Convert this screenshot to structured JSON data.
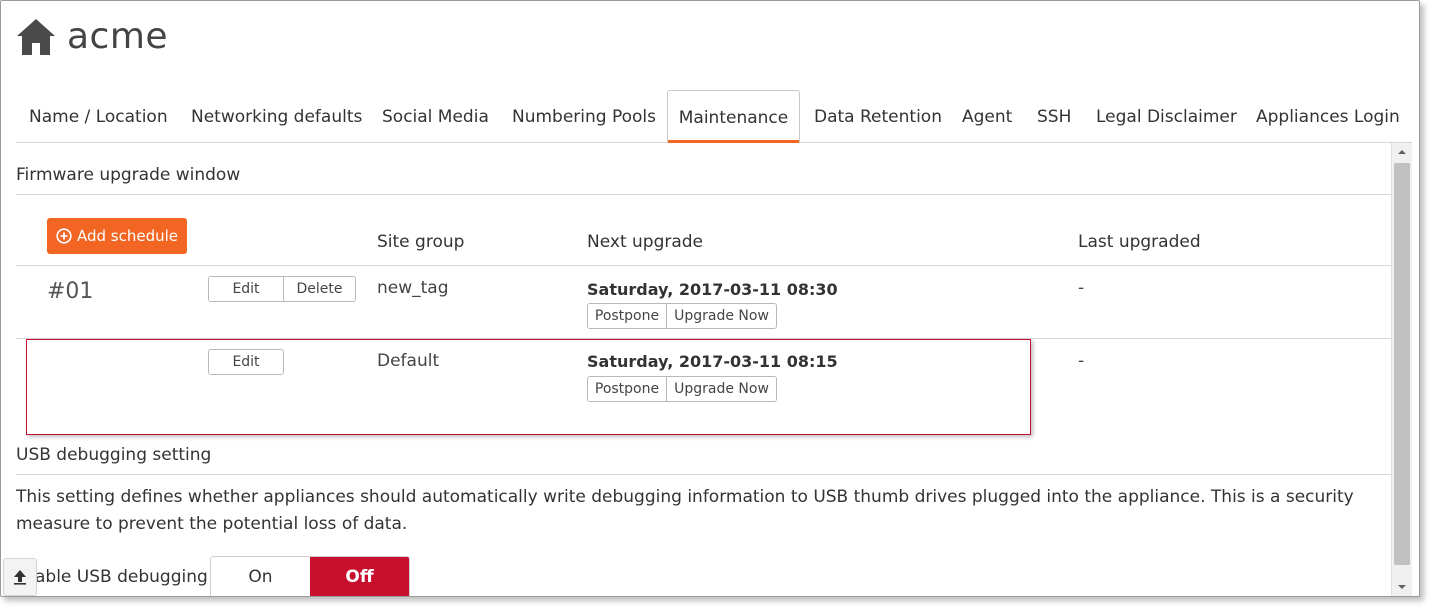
{
  "brand": {
    "name": "acme",
    "icon": "home-icon"
  },
  "tabs": [
    {
      "label": "Name / Location",
      "active": false
    },
    {
      "label": "Networking defaults",
      "active": false
    },
    {
      "label": "Social Media",
      "active": false
    },
    {
      "label": "Numbering Pools",
      "active": false
    },
    {
      "label": "Maintenance",
      "active": true
    },
    {
      "label": "Data Retention",
      "active": false
    },
    {
      "label": "Agent",
      "active": false
    },
    {
      "label": "SSH",
      "active": false
    },
    {
      "label": "Legal Disclaimer",
      "active": false
    },
    {
      "label": "Appliances Login",
      "active": false
    }
  ],
  "firmware": {
    "title": "Firmware upgrade window",
    "add_button": "Add schedule",
    "add_icon": "plus-circle-icon",
    "columns": {
      "site_group": "Site group",
      "next_upgrade": "Next upgrade",
      "last_upgraded": "Last upgraded"
    },
    "rows": [
      {
        "number": "#01",
        "edit": "Edit",
        "delete": "Delete",
        "site_group": "new_tag",
        "next_upgrade": "Saturday, 2017-03-11 08:30",
        "postpone": "Postpone",
        "upgrade_now": "Upgrade Now",
        "last_upgraded": "-"
      },
      {
        "number": "",
        "edit": "Edit",
        "site_group": "Default",
        "next_upgrade": "Saturday, 2017-03-11 08:15",
        "postpone": "Postpone",
        "upgrade_now": "Upgrade Now",
        "last_upgraded": "-"
      }
    ]
  },
  "usb": {
    "title": "USB debugging setting",
    "description": "This setting defines whether appliances should automatically write debugging information to USB thumb drives plugged into the appliance. This is a security measure to prevent the potential loss of data.",
    "toggle_label": "able USB debugging",
    "on_label": "On",
    "off_label": "Off",
    "selected": "Off"
  },
  "colors": {
    "accent": "#f26522",
    "off_active": "#c8102e",
    "highlight_border": "#c8102e"
  }
}
